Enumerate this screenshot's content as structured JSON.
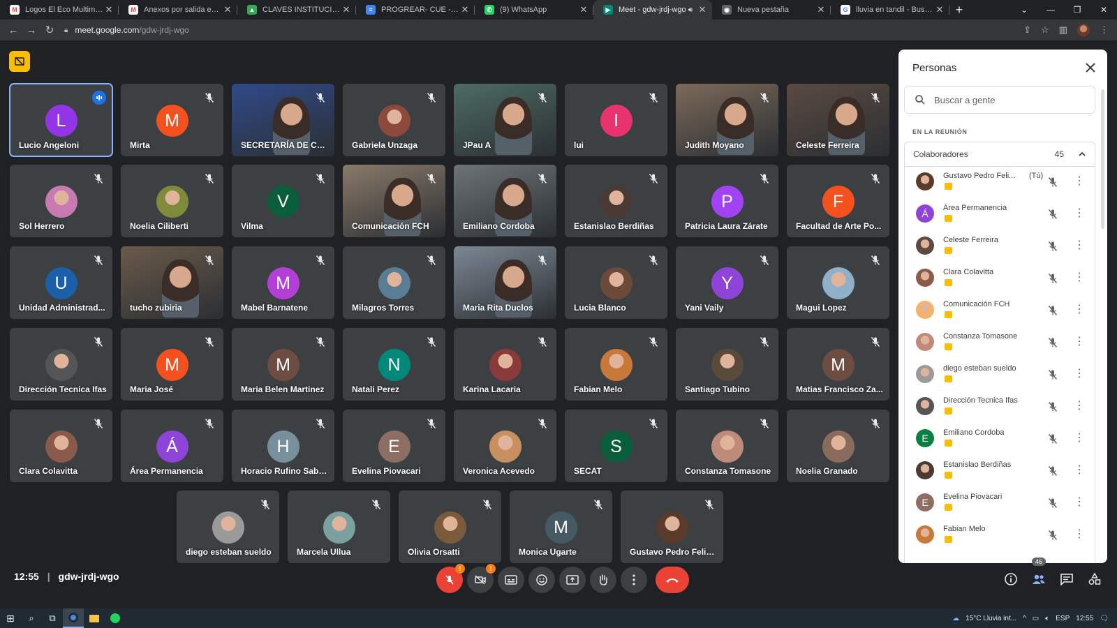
{
  "browser": {
    "tabs": [
      {
        "title": "Logos El Eco Multimedios",
        "favicon": "gmail",
        "active": false
      },
      {
        "title": "Anexos por salida educativ",
        "favicon": "gmail",
        "active": false
      },
      {
        "title": "CLAVES INSTITUCIONALES",
        "favicon": "drive",
        "active": false
      },
      {
        "title": "PROGREAR- CUE - Docum",
        "favicon": "docs",
        "active": false
      },
      {
        "title": "(9) WhatsApp",
        "favicon": "whatsapp",
        "active": false
      },
      {
        "title": "Meet - gdw-jrdj-wgo",
        "favicon": "meet",
        "active": true
      },
      {
        "title": "Nueva pestaña",
        "favicon": "chrome",
        "active": false
      },
      {
        "title": "lluvia en tandil - Buscar co",
        "favicon": "google",
        "active": false
      }
    ],
    "url_domain": "meet.google.com",
    "url_path": "/gdw-jrdj-wgo"
  },
  "meeting": {
    "time": "12:55",
    "code": "gdw-jrdj-wgo"
  },
  "colors": {
    "accent": "#8ab4f8",
    "danger": "#ea4335",
    "warning": "#fa7b17",
    "host_badge": "#fbbc04"
  },
  "tiles": [
    {
      "name": "Lucio Angeloni",
      "type": "avatar",
      "initial": "L",
      "color": "#9334e6",
      "speaking": true
    },
    {
      "name": "Mirta",
      "type": "avatar",
      "initial": "M",
      "color": "#f4511e"
    },
    {
      "name": "SECRETARÍA DE CA...",
      "type": "video",
      "color": "#2f4a8a"
    },
    {
      "name": "Gabriela Unzaga",
      "type": "photo",
      "color": "#8d4a3c"
    },
    {
      "name": "JPau A",
      "type": "video",
      "color": "#4d6b63"
    },
    {
      "name": "lui",
      "type": "avatar",
      "initial": "l",
      "color": "#e8336d"
    },
    {
      "name": "Judith Moyano",
      "type": "video",
      "color": "#7c6a5a"
    },
    {
      "name": "Celeste Ferreira",
      "type": "video",
      "color": "#5a4a42"
    },
    {
      "name": "Sol Herrero",
      "type": "photo",
      "color": "#c77bb0"
    },
    {
      "name": "Noelia Ciliberti",
      "type": "photo",
      "color": "#7f8a3a"
    },
    {
      "name": "Vilma",
      "type": "avatar",
      "initial": "V",
      "color": "#0b5e3c"
    },
    {
      "name": "Comunicación FCH",
      "type": "video",
      "color": "#8a7a6a"
    },
    {
      "name": "Emiliano Cordoba",
      "type": "video",
      "color": "#6d7478"
    },
    {
      "name": "Estanislao Berdiñas",
      "type": "photo",
      "color": "#4b3a33"
    },
    {
      "name": "Patricia Laura Zárate",
      "type": "avatar",
      "initial": "P",
      "color": "#a142f4"
    },
    {
      "name": "Facultad de Arte Po...",
      "type": "avatar",
      "initial": "F",
      "color": "#f4511e"
    },
    {
      "name": "Unidad Administrad...",
      "type": "avatar",
      "initial": "U",
      "color": "#1a5fa8"
    },
    {
      "name": "tucho zubiria",
      "type": "video",
      "color": "#6a5a4a"
    },
    {
      "name": "Mabel Barnatene",
      "type": "avatar",
      "initial": "M",
      "color": "#b43fd6"
    },
    {
      "name": "Milagros Torres",
      "type": "photo",
      "color": "#5a7d96"
    },
    {
      "name": "Maria Rita Duclos",
      "type": "video",
      "color": "#7d8894"
    },
    {
      "name": "Lucia Blanco",
      "type": "photo",
      "color": "#6b4a3a"
    },
    {
      "name": "Yani Vaily",
      "type": "avatar",
      "initial": "Y",
      "color": "#8e44d6"
    },
    {
      "name": "Magui Lopez",
      "type": "photo",
      "color": "#8fb0c8"
    },
    {
      "name": "Dirección Tecnica Ifas",
      "type": "photo",
      "color": "#555"
    },
    {
      "name": "Maria José",
      "type": "avatar",
      "initial": "M",
      "color": "#f4511e"
    },
    {
      "name": "Maria Belen Martinez",
      "type": "avatar",
      "initial": "M",
      "color": "#6d4c41"
    },
    {
      "name": "Natali Perez",
      "type": "avatar",
      "initial": "N",
      "color": "#00897b"
    },
    {
      "name": "Karina Lacaria",
      "type": "photo",
      "color": "#8a3a3a"
    },
    {
      "name": "Fabian Melo",
      "type": "photo",
      "color": "#c8793a"
    },
    {
      "name": "Santiago Tubino",
      "type": "photo",
      "color": "#5a4a3a"
    },
    {
      "name": "Matias Francisco Za...",
      "type": "avatar",
      "initial": "M",
      "color": "#6d4c41"
    },
    {
      "name": "Clara Colavitta",
      "type": "photo",
      "color": "#8a5a4a"
    },
    {
      "name": "Área Permanencia",
      "type": "avatar",
      "initial": "Á",
      "color": "#8e44d6"
    },
    {
      "name": "Horacio Rufino Saba...",
      "type": "avatar",
      "initial": "H",
      "color": "#78909c"
    },
    {
      "name": "Evelina Piovacari",
      "type": "avatar",
      "initial": "E",
      "color": "#8d6e63"
    },
    {
      "name": "Veronica Acevedo",
      "type": "photo",
      "color": "#c89060"
    },
    {
      "name": "SECAT",
      "type": "avatar",
      "initial": "S",
      "color": "#0b5e3c"
    },
    {
      "name": "Constanza Tomasone",
      "type": "photo",
      "color": "#c08a7a"
    },
    {
      "name": "Noelia Granado",
      "type": "photo",
      "color": "#8a6a5a"
    },
    {
      "name": "diego esteban sueldo",
      "type": "photo",
      "color": "#9a9a9a"
    },
    {
      "name": "Marcela Ullua",
      "type": "photo",
      "color": "#7aa0a0"
    },
    {
      "name": "Olivia Orsatti",
      "type": "photo",
      "color": "#7a5a3a"
    },
    {
      "name": "Monica Ugarte",
      "type": "avatar",
      "initial": "M",
      "color": "#455a64"
    },
    {
      "name": "Gustavo Pedro Felix ...",
      "type": "photo",
      "color": "#5a3a2a"
    }
  ],
  "panel": {
    "title": "Personas",
    "search_placeholder": "Buscar a gente",
    "section_label": "EN LA REUNIÓN",
    "group_label": "Colaboradores",
    "group_count": "45",
    "participants": [
      {
        "name": "Gustavo Pedro Feli...",
        "suffix": "(Tú)",
        "type": "photo",
        "color": "#5a3a2a"
      },
      {
        "name": "Área Permanencia",
        "type": "avatar",
        "initial": "Á",
        "color": "#8e44d6"
      },
      {
        "name": "Celeste Ferreira",
        "type": "photo",
        "color": "#5a4a42"
      },
      {
        "name": "Clara Colavitta",
        "type": "photo",
        "color": "#8a5a4a"
      },
      {
        "name": "Comunicación FCH",
        "type": "photo",
        "color": "#f6b26b"
      },
      {
        "name": "Constanza Tomasone",
        "type": "photo",
        "color": "#c08a7a"
      },
      {
        "name": "diego esteban sueldo",
        "type": "photo",
        "color": "#9a9a9a"
      },
      {
        "name": "Dirección Tecnica Ifas",
        "type": "photo",
        "color": "#555"
      },
      {
        "name": "Emiliano Cordoba",
        "type": "avatar",
        "initial": "E",
        "color": "#0b8043"
      },
      {
        "name": "Estanislao Berdiñas",
        "type": "photo",
        "color": "#4b3a33"
      },
      {
        "name": "Evelina Piovacari",
        "type": "avatar",
        "initial": "E",
        "color": "#8d6e63"
      },
      {
        "name": "Fabian Melo",
        "type": "photo",
        "color": "#c8793a"
      }
    ]
  },
  "controls": {
    "people_count": "46",
    "warning_mark": "!"
  },
  "taskbar": {
    "weather": "15°C  Lluvia int...",
    "lang": "ESP",
    "time": "12:55"
  }
}
